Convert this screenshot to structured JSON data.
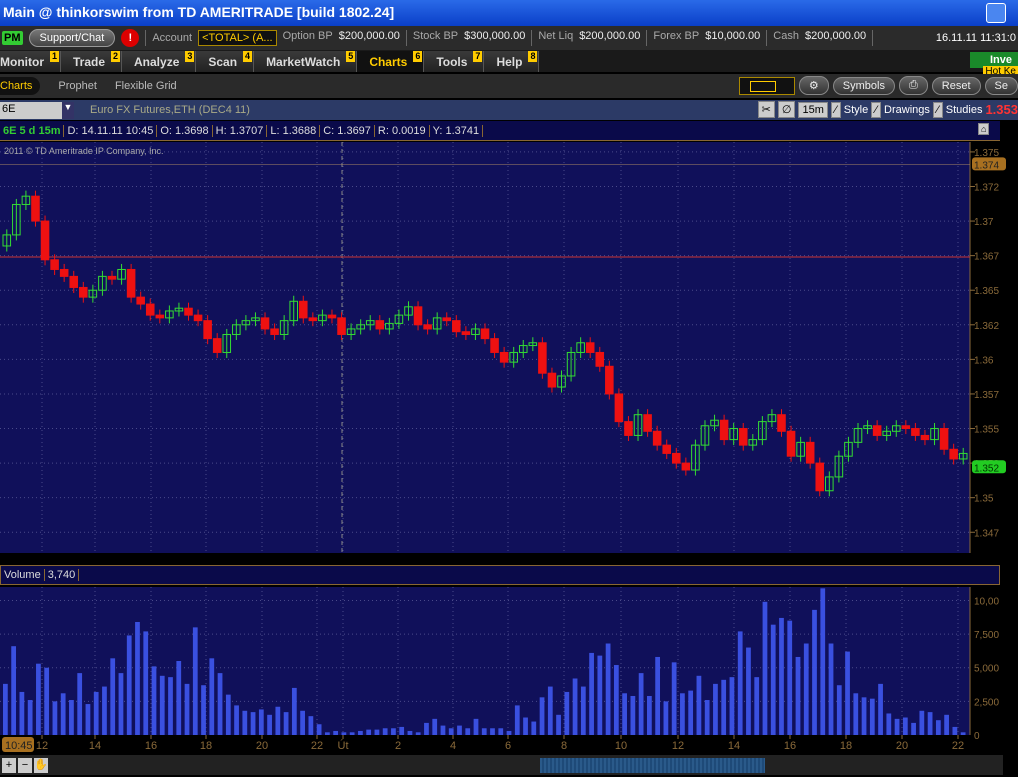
{
  "window": {
    "title": "Main @ thinkorswim from TD AMERITRADE [build 1802.24]"
  },
  "account_bar": {
    "pm": "PM",
    "support": "Support/Chat",
    "alert": "!",
    "account_label": "Account",
    "account_value": "<TOTAL> (A...",
    "fields": [
      {
        "label": "Option BP",
        "value": "$200,000.00"
      },
      {
        "label": "Stock BP",
        "value": "$300,000.00"
      },
      {
        "label": "Net Liq",
        "value": "$200,000.00"
      },
      {
        "label": "Forex BP",
        "value": "$10,000.00"
      },
      {
        "label": "Cash",
        "value": "$200,000.00"
      }
    ],
    "datetime": "16.11.11 11:31:0"
  },
  "tabs": [
    {
      "label": "Monitor",
      "num": "1"
    },
    {
      "label": "Trade",
      "num": "2"
    },
    {
      "label": "Analyze",
      "num": "3"
    },
    {
      "label": "Scan",
      "num": "4"
    },
    {
      "label": "MarketWatch",
      "num": "5"
    },
    {
      "label": "Charts",
      "num": "6",
      "active": true
    },
    {
      "label": "Tools",
      "num": "7"
    },
    {
      "label": "Help",
      "num": "8"
    }
  ],
  "invest": "Inve",
  "hotkey": "Hot Ke",
  "subtabs": [
    {
      "label": "Charts",
      "active": true
    },
    {
      "label": "Prophet"
    },
    {
      "label": "Flexible Grid"
    }
  ],
  "sub_buttons": {
    "symbols": "Symbols",
    "reset": "Reset",
    "more": "Se"
  },
  "chart_toolbar": {
    "symbol": "6E",
    "description": "Euro FX Futures,ETH (DEC4 11)",
    "interval": "15m",
    "style": "Style",
    "drawings": "Drawings",
    "studies": "Studies",
    "last": "1.353"
  },
  "info_row": [
    "6E 5 d 15m",
    "D: 14.11.11 10:45",
    "O: 1.3698",
    "H: 1.3707",
    "L: 1.3688",
    "C: 1.3697",
    "R: 0.0019",
    "Y: 1.3741"
  ],
  "watermark": "2011 © TD Ameritrade IP Company, Inc.",
  "colors": {
    "up": "#33dd33",
    "down": "#ee1111",
    "bg": "#10105a",
    "volume": "#3a50e0",
    "axis": "#8a6a3a"
  },
  "chart_data": [
    {
      "type": "candlestick",
      "ylim": [
        1.346,
        1.3755
      ],
      "yticks": [
        "1.375",
        "1.372",
        "1.37",
        "1.367",
        "1.365",
        "1.362",
        "1.36",
        "1.357",
        "1.355",
        "1.352",
        "1.35",
        "1.347"
      ],
      "ytick_values": [
        1.375,
        1.3725,
        1.37,
        1.3675,
        1.365,
        1.3625,
        1.36,
        1.3575,
        1.355,
        1.3525,
        1.35,
        1.3475
      ],
      "price_markers": {
        "prev_close": "1.374",
        "last": "1.352"
      },
      "hline": 1.3674,
      "closes": [
        1.369,
        1.3712,
        1.3718,
        1.37,
        1.3672,
        1.3665,
        1.366,
        1.3652,
        1.3645,
        1.365,
        1.366,
        1.3658,
        1.3665,
        1.3645,
        1.364,
        1.3632,
        1.363,
        1.3635,
        1.3637,
        1.3632,
        1.3628,
        1.3615,
        1.3605,
        1.3618,
        1.3625,
        1.3628,
        1.363,
        1.3622,
        1.3618,
        1.3628,
        1.3642,
        1.363,
        1.3628,
        1.3632,
        1.363,
        1.3618,
        1.3622,
        1.3625,
        1.3628,
        1.3622,
        1.3626,
        1.3632,
        1.3638,
        1.3625,
        1.3622,
        1.363,
        1.3628,
        1.362,
        1.3618,
        1.3622,
        1.3615,
        1.3605,
        1.3598,
        1.3605,
        1.361,
        1.3612,
        1.359,
        1.358,
        1.3588,
        1.3605,
        1.3612,
        1.3605,
        1.3595,
        1.3575,
        1.3555,
        1.3545,
        1.356,
        1.3548,
        1.3538,
        1.3532,
        1.3525,
        1.352,
        1.3538,
        1.3552,
        1.3556,
        1.3542,
        1.355,
        1.3538,
        1.3542,
        1.3555,
        1.356,
        1.3548,
        1.353,
        1.354,
        1.3525,
        1.3505,
        1.3515,
        1.353,
        1.354,
        1.355,
        1.3552,
        1.3545,
        1.3548,
        1.3552,
        1.355,
        1.3545,
        1.3542,
        1.355,
        1.3535,
        1.3528,
        1.3532
      ]
    },
    {
      "type": "bar",
      "title": "Volume",
      "current": "3,740",
      "ylim": [
        0,
        11000
      ],
      "yticks": [
        "10,00",
        "7,500",
        "5,000",
        "2,500",
        "0"
      ],
      "ytick_values": [
        10000,
        7500,
        5000,
        2500,
        0
      ],
      "xticks": [
        "12",
        "14",
        "16",
        "18",
        "20",
        "22",
        "Út",
        "2",
        "4",
        "6",
        "8",
        "10",
        "12",
        "14",
        "16",
        "18",
        "20",
        "22"
      ],
      "cursor_time": "10:45",
      "values": [
        3800,
        6600,
        3200,
        2600,
        5300,
        5000,
        2500,
        3100,
        2600,
        4600,
        2300,
        3200,
        3600,
        5700,
        4600,
        7400,
        8400,
        7700,
        5100,
        4400,
        4300,
        5500,
        3800,
        8000,
        3700,
        5700,
        4600,
        3000,
        2200,
        1800,
        1700,
        1900,
        1500,
        2100,
        1700,
        3500,
        1800,
        1400,
        800,
        200,
        300,
        200,
        200,
        300,
        400,
        400,
        500,
        500,
        600,
        300,
        200,
        900,
        1200,
        700,
        500,
        700,
        500,
        1200,
        500,
        500,
        500,
        300,
        2200,
        1300,
        1000,
        2800,
        3600,
        1500,
        3200,
        4200,
        3600,
        6100,
        5900,
        6800,
        5200,
        3100,
        2900,
        4600,
        2900,
        5800,
        2500,
        5400,
        3100,
        3300,
        4400,
        2600,
        3800,
        4100,
        4300,
        7700,
        6500,
        4300,
        9900,
        8200,
        8700,
        8500,
        5800,
        6800,
        9300,
        10900,
        6800,
        3700,
        6200,
        3100,
        2800,
        2700,
        3800,
        1600,
        1200,
        1300,
        900,
        1800,
        1700,
        1100,
        1500,
        600,
        200
      ]
    }
  ]
}
